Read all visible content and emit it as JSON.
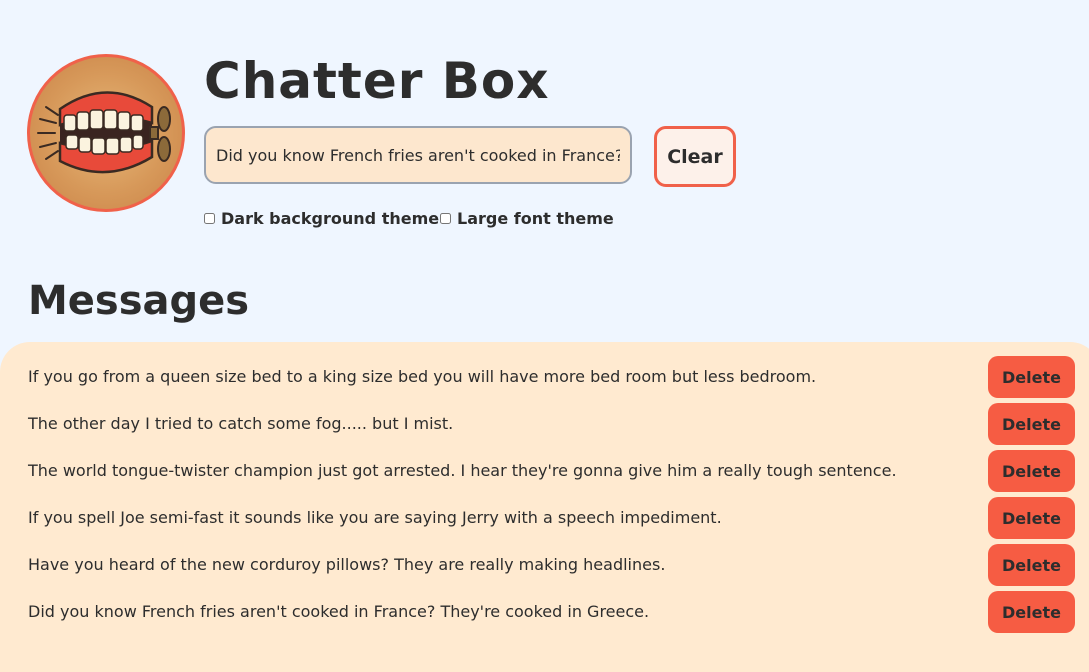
{
  "app": {
    "title": "Chatter Box",
    "logo_icon": "wind-up-teeth-icon"
  },
  "composer": {
    "input_value": "Did you know French fries aren't cooked in France? They're cooked in Greece.",
    "clear_label": "Clear"
  },
  "options": {
    "dark_label": "Dark background theme",
    "dark_checked": false,
    "large_label": "Large font theme",
    "large_checked": false
  },
  "messages_section": {
    "title": "Messages",
    "delete_label": "Delete",
    "items": [
      {
        "text": "If you go from a queen size bed to a king size bed you will have more bed room but less bedroom."
      },
      {
        "text": "The other day I tried to catch some fog..... but I mist."
      },
      {
        "text": "The world tongue-twister champion just got arrested. I hear they're gonna give him a really tough sentence."
      },
      {
        "text": "If you spell Joe semi-fast it sounds like you are saying Jerry with a speech impediment."
      },
      {
        "text": "Have you heard of the new corduroy pillows? They are really making headlines."
      },
      {
        "text": "Did you know French fries aren't cooked in France? They're cooked in Greece."
      }
    ]
  },
  "colors": {
    "page_bg": "#eff6ff",
    "accent": "#f65c43",
    "panel_bg": "#ffead0",
    "input_bg": "#fde7ce"
  }
}
